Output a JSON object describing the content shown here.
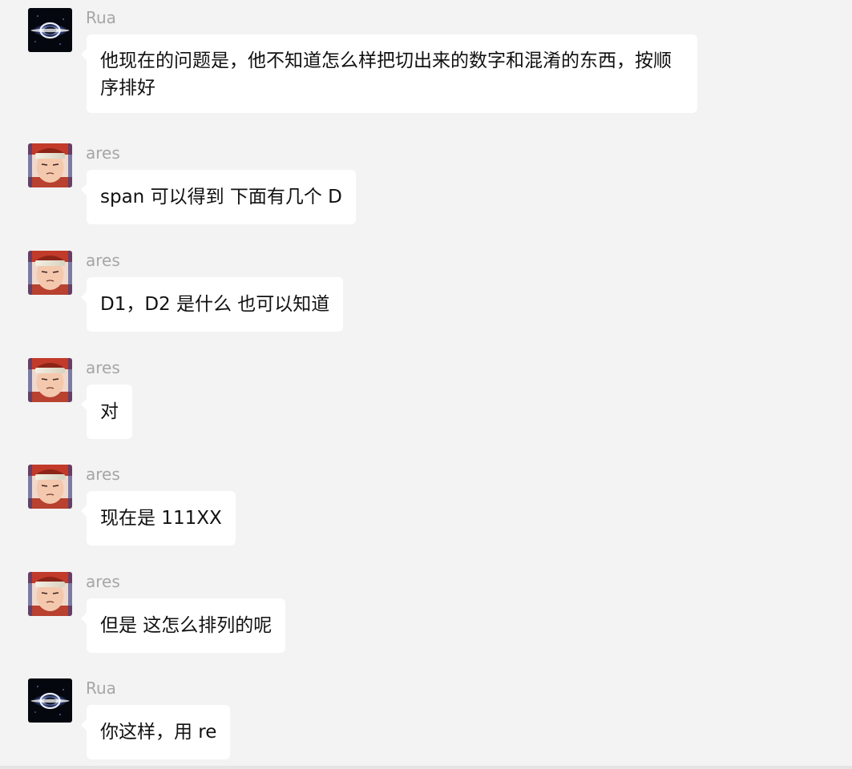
{
  "messages": [
    {
      "sender": "Rua",
      "avatar": "galaxy-avatar-icon",
      "text": "他现在的问题是，他不知道怎么样把切出来的数字和混淆的东西，按顺序排好"
    },
    {
      "sender": "ares",
      "avatar": "anime-character-avatar-icon",
      "text": "span 可以得到 下面有几个 D"
    },
    {
      "sender": "ares",
      "avatar": "anime-character-avatar-icon",
      "text": "D1，D2 是什么 也可以知道"
    },
    {
      "sender": "ares",
      "avatar": "anime-character-avatar-icon",
      "text": "对"
    },
    {
      "sender": "ares",
      "avatar": "anime-character-avatar-icon",
      "text": "现在是 111XX"
    },
    {
      "sender": "ares",
      "avatar": "anime-character-avatar-icon",
      "text": "但是 这怎么排列的呢"
    },
    {
      "sender": "Rua",
      "avatar": "galaxy-avatar-icon",
      "text": "你这样，用 re"
    }
  ],
  "colors": {
    "background": "#f3f3f3",
    "bubble": "#ffffff",
    "sender_name": "#a6a6a6",
    "text": "#111111"
  }
}
